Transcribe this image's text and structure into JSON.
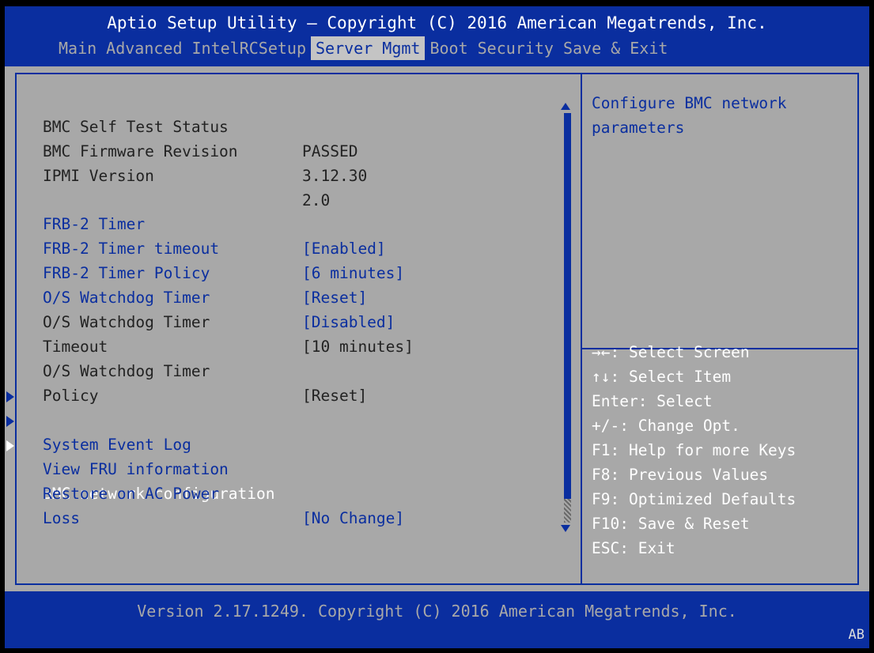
{
  "header": {
    "title": "Aptio Setup Utility – Copyright (C) 2016 American Megatrends, Inc.",
    "tabs": [
      {
        "label": "Main",
        "active": false
      },
      {
        "label": "Advanced",
        "active": false
      },
      {
        "label": "IntelRCSetup",
        "active": false
      },
      {
        "label": "Server Mgmt",
        "active": true
      },
      {
        "label": "Boot",
        "active": false
      },
      {
        "label": "Security",
        "active": false
      },
      {
        "label": "Save & Exit",
        "active": false
      }
    ]
  },
  "info": {
    "bmc_self_test_label": "BMC Self Test Status",
    "bmc_self_test_value": "PASSED",
    "bmc_firmware_label": "BMC Firmware Revision",
    "bmc_firmware_value": "3.12.30",
    "ipmi_label": "IPMI Version",
    "ipmi_value": "2.0"
  },
  "settings": {
    "frb2_timer_label": "FRB-2 Timer",
    "frb2_timer_value": "[Enabled]",
    "frb2_timeout_label": "FRB-2 Timer timeout",
    "frb2_timeout_value": "[6 minutes]",
    "frb2_policy_label": "FRB-2 Timer Policy",
    "frb2_policy_value": "[Reset]",
    "os_wd_label": "O/S Watchdog Timer",
    "os_wd_value": "[Disabled]",
    "os_wd_timeout_label_1": "O/S Watchdog Timer",
    "os_wd_timeout_label_2": "Timeout",
    "os_wd_timeout_value": "[10 minutes]",
    "os_wd_policy_label_1": "O/S Watchdog Timer",
    "os_wd_policy_label_2": "Policy",
    "os_wd_policy_value": "[Reset]",
    "restore_ac_label_1": "Restore on AC Power",
    "restore_ac_label_2": "Loss",
    "restore_ac_value": "[No Change]"
  },
  "submenus": {
    "system_event_log": "System Event Log",
    "view_fru": "View FRU information",
    "bmc_network": "BMC network configuration"
  },
  "help": {
    "description": "Configure BMC network parameters",
    "keys": [
      "→←: Select Screen",
      "↑↓: Select Item",
      "Enter: Select",
      "+/-: Change Opt.",
      "F1: Help for more Keys",
      "F8: Previous Values",
      "F9: Optimized Defaults",
      "F10: Save & Reset",
      "ESC: Exit"
    ]
  },
  "footer": {
    "version": "Version 2.17.1249. Copyright (C) 2016 American Megatrends, Inc.",
    "corner": "AB"
  },
  "colors": {
    "bios_blue": "#0a2e9f",
    "panel_gray": "#a8a8a8",
    "highlight_white": "#ffffff"
  }
}
